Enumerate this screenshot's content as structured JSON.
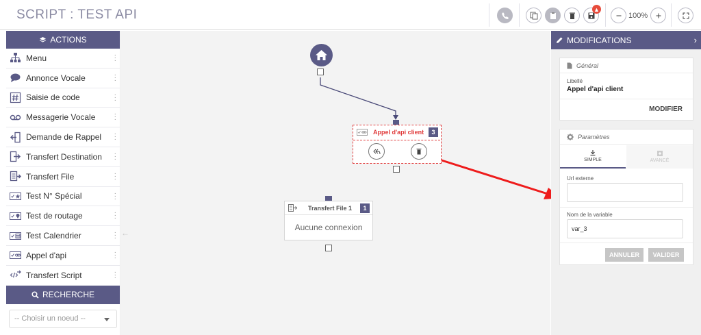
{
  "header": {
    "title": "SCRIPT : TEST API",
    "zoom": "100%",
    "badge_icon": "warning"
  },
  "sidebar": {
    "actions_title": "ACTIONS",
    "items": [
      {
        "label": "Menu",
        "icon": "sitemap-icon"
      },
      {
        "label": "Annonce Vocale",
        "icon": "speech-bubble-icon"
      },
      {
        "label": "Saisie de code",
        "icon": "hash-icon"
      },
      {
        "label": "Messagerie Vocale",
        "icon": "voicemail-icon"
      },
      {
        "label": "Demande de Rappel",
        "icon": "callback-icon"
      },
      {
        "label": "Transfert Destination",
        "icon": "transfer-exit-icon"
      },
      {
        "label": "Transfert File",
        "icon": "transfer-file-icon"
      },
      {
        "label": "Test N° Spécial",
        "icon": "test-star-icon"
      },
      {
        "label": "Test de routage",
        "icon": "test-pin-icon"
      },
      {
        "label": "Test Calendrier",
        "icon": "test-calendar-icon"
      },
      {
        "label": "Appel d'api",
        "icon": "test-link-icon"
      },
      {
        "label": "Transfert Script",
        "icon": "transfer-script-icon"
      }
    ],
    "search_title": "RECHERCHE",
    "select_placeholder": "-- Choisir un noeud --"
  },
  "canvas": {
    "node_api": {
      "title": "Appel d'api client",
      "number": "3"
    },
    "node_file": {
      "title": "Transfert File 1",
      "number": "1",
      "body": "Aucune connexion"
    }
  },
  "panel": {
    "title": "MODIFICATIONS",
    "general": {
      "title": "Général",
      "label_caption": "Libellé",
      "label_value": "Appel d'api client",
      "modify_button": "MODIFIER"
    },
    "params": {
      "title": "Paramètres",
      "tab_simple": "SIMPLE",
      "tab_advanced": "AVANCÉ",
      "url_label": "Url externe",
      "url_value": "",
      "var_label": "Nom de la variable",
      "var_value": "var_3",
      "cancel_button": "ANNULER",
      "validate_button": "VALIDER"
    }
  },
  "colors": {
    "accent": "#5a5a86",
    "selection": "#e03b3b",
    "canvas": "#f3f3f3"
  }
}
